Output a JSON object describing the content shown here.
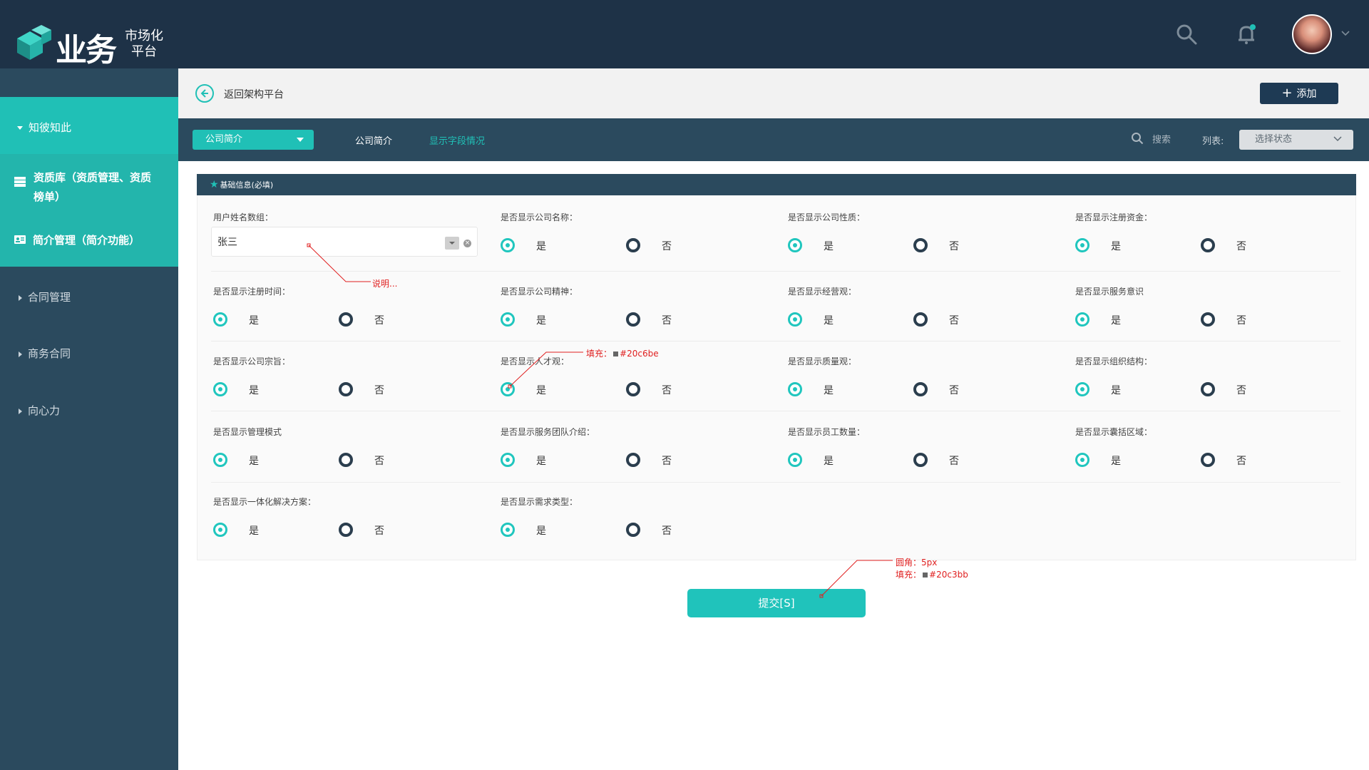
{
  "header": {
    "logo_big": "业务",
    "logo_small_line1": "市场化",
    "logo_small_line2": "平台"
  },
  "sidebar": {
    "items": [
      {
        "label": "知彼知此"
      },
      {
        "label_line1": "资质库（资质管理、资质",
        "label_line2": "榜单）"
      },
      {
        "label": "简介管理（简介功能）"
      },
      {
        "label": "合同管理"
      },
      {
        "label": "商务合同"
      },
      {
        "label": "向心力"
      }
    ]
  },
  "breadcrumb": {
    "back_label": "返回架构平台",
    "add_label": "添加"
  },
  "filterbar": {
    "select_value": "公司简介",
    "tab1": "公司简介",
    "tab2": "显示字段情况",
    "search_label": "搜索",
    "list_label": "列表:",
    "status_placeholder": "选择状态"
  },
  "form": {
    "section_title": "基础信息(必填)",
    "name_label": "用户姓名数组：",
    "name_value": "张三",
    "yes": "是",
    "no": "否",
    "fields": [
      "是否显示公司名称：",
      "是否显示公司性质：",
      "是否显示注册资金：",
      "是否显示注册时间：",
      "是否显示公司精神：",
      "是否显示经营观：",
      "是否显示服务意识",
      "是否显示公司宗旨：",
      "是否显示人才观：",
      "是否显示质量观：",
      "是否显示组织结构：",
      "是否显示管理模式",
      "是否显示服务团队介绍：",
      "是否显示员工数量：",
      "是否显示囊括区域：",
      "是否显示一体化解决方案：",
      "是否显示需求类型："
    ],
    "submit_label": "提交[S]"
  },
  "annotations": {
    "note": "说明...",
    "fill_radio": "填充：",
    "fill_radio_color": "#20c6be",
    "radius": "圆角：5px",
    "fill_btn": "填充：",
    "fill_btn_color": "#20c3bb"
  },
  "colors": {
    "header_bg": "#1e3247",
    "sidebar_bg": "#2b4a5e",
    "accent": "#20c0b6",
    "radio_fill": "#20c6be",
    "submit_fill": "#20c3bb"
  }
}
